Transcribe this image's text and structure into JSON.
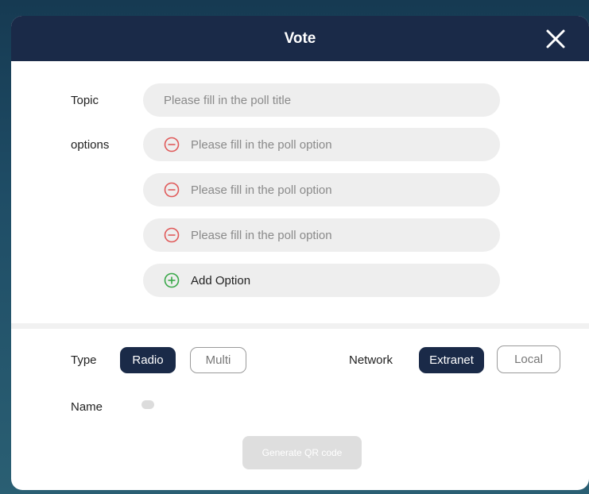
{
  "dialog": {
    "title": "Vote"
  },
  "form": {
    "topic_label": "Topic",
    "topic_placeholder": "Please fill in the poll title",
    "options_label": "options",
    "options": [
      {
        "placeholder": "Please fill in the poll option"
      },
      {
        "placeholder": "Please fill in the poll option"
      },
      {
        "placeholder": "Please fill in the poll option"
      }
    ],
    "add_option_label": "Add Option"
  },
  "settings": {
    "type_label": "Type",
    "type_options": [
      "Radio",
      "Multi"
    ],
    "type_selected": "Radio",
    "network_label": "Network",
    "network_options": [
      "Extranet",
      "Local"
    ],
    "network_selected": "Extranet",
    "name_label": "Name",
    "name_toggle_on": false
  },
  "actions": {
    "generate_label": "Generate QR code"
  },
  "icons": {
    "close": "close-icon",
    "remove": "minus-circle-icon",
    "add": "plus-circle-icon"
  },
  "colors": {
    "header_bg": "#1a2a48",
    "remove_icon": "#e05a5a",
    "add_icon": "#3aa84a",
    "selected_button": "#1a2a48"
  }
}
